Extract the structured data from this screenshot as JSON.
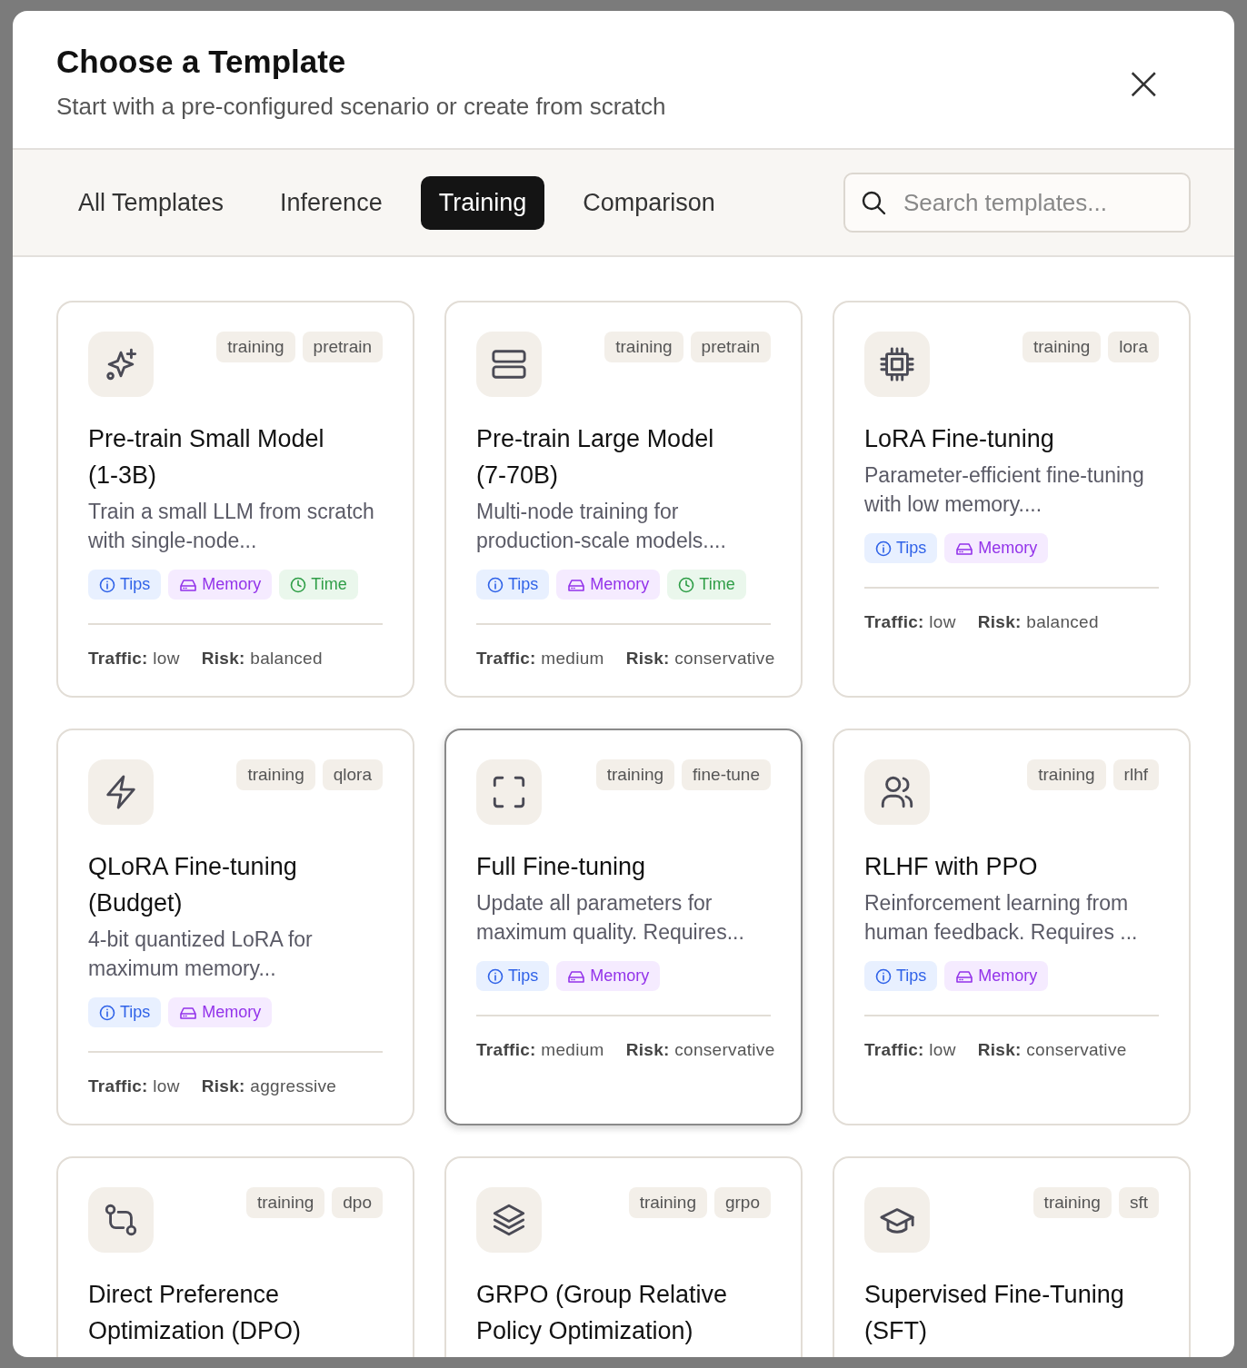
{
  "dialog": {
    "title": "Choose a Template",
    "subtitle": "Start with a pre-configured scenario or create from scratch",
    "close": "×"
  },
  "tabs": [
    {
      "label": "All Templates",
      "selected": false
    },
    {
      "label": "Inference",
      "selected": false
    },
    {
      "label": "Training",
      "selected": true
    },
    {
      "label": "Comparison",
      "selected": false
    }
  ],
  "search": {
    "placeholder": "Search templates..."
  },
  "templates": [
    {
      "title": "Pre-train Small Model (1-3B)",
      "description": "Train a small LLM from scratch with single-node...",
      "tags": [
        "training",
        "pretrain"
      ],
      "badges": [
        {
          "kind": "tips",
          "label": "Tips"
        },
        {
          "kind": "memory",
          "label": "Memory"
        },
        {
          "kind": "time",
          "label": "Time"
        }
      ],
      "traffic_label": "Traffic:",
      "traffic": "low",
      "risk_label": "Risk:",
      "risk": "balanced",
      "highlighted": false
    },
    {
      "title": "Pre-train Large Model (7-70B)",
      "description": "Multi-node training for production-scale models....",
      "tags": [
        "training",
        "pretrain"
      ],
      "badges": [
        {
          "kind": "tips",
          "label": "Tips"
        },
        {
          "kind": "memory",
          "label": "Memory"
        },
        {
          "kind": "time",
          "label": "Time"
        }
      ],
      "traffic_label": "Traffic:",
      "traffic": "medium",
      "risk_label": "Risk:",
      "risk": "conservative",
      "highlighted": false
    },
    {
      "title": "LoRA Fine-tuning",
      "description": "Parameter-efficient fine-tuning with low memory....",
      "tags": [
        "training",
        "lora"
      ],
      "badges": [
        {
          "kind": "tips",
          "label": "Tips"
        },
        {
          "kind": "memory",
          "label": "Memory"
        }
      ],
      "traffic_label": "Traffic:",
      "traffic": "low",
      "risk_label": "Risk:",
      "risk": "balanced",
      "highlighted": false
    },
    {
      "title": "QLoRA Fine-tuning (Budget)",
      "description": "4-bit quantized LoRA for maximum memory...",
      "tags": [
        "training",
        "qlora"
      ],
      "badges": [
        {
          "kind": "tips",
          "label": "Tips"
        },
        {
          "kind": "memory",
          "label": "Memory"
        }
      ],
      "traffic_label": "Traffic:",
      "traffic": "low",
      "risk_label": "Risk:",
      "risk": "aggressive",
      "highlighted": false
    },
    {
      "title": "Full Fine-tuning",
      "description": "Update all parameters for maximum quality. Requires...",
      "tags": [
        "training",
        "fine-tune"
      ],
      "badges": [
        {
          "kind": "tips",
          "label": "Tips"
        },
        {
          "kind": "memory",
          "label": "Memory"
        }
      ],
      "traffic_label": "Traffic:",
      "traffic": "medium",
      "risk_label": "Risk:",
      "risk": "conservative",
      "highlighted": true
    },
    {
      "title": "RLHF with PPO",
      "description": "Reinforcement learning from human feedback. Requires ...",
      "tags": [
        "training",
        "rlhf"
      ],
      "badges": [
        {
          "kind": "tips",
          "label": "Tips"
        },
        {
          "kind": "memory",
          "label": "Memory"
        }
      ],
      "traffic_label": "Traffic:",
      "traffic": "low",
      "risk_label": "Risk:",
      "risk": "conservative",
      "highlighted": false
    },
    {
      "title": "Direct Preference Optimization (DPO)",
      "tags": [
        "training",
        "dpo"
      ],
      "highlighted": false
    },
    {
      "title": "GRPO (Group Relative Policy Optimization)",
      "tags": [
        "training",
        "grpo"
      ],
      "highlighted": false
    },
    {
      "title": "Supervised Fine-Tuning (SFT)",
      "tags": [
        "training",
        "sft"
      ],
      "highlighted": false
    }
  ]
}
